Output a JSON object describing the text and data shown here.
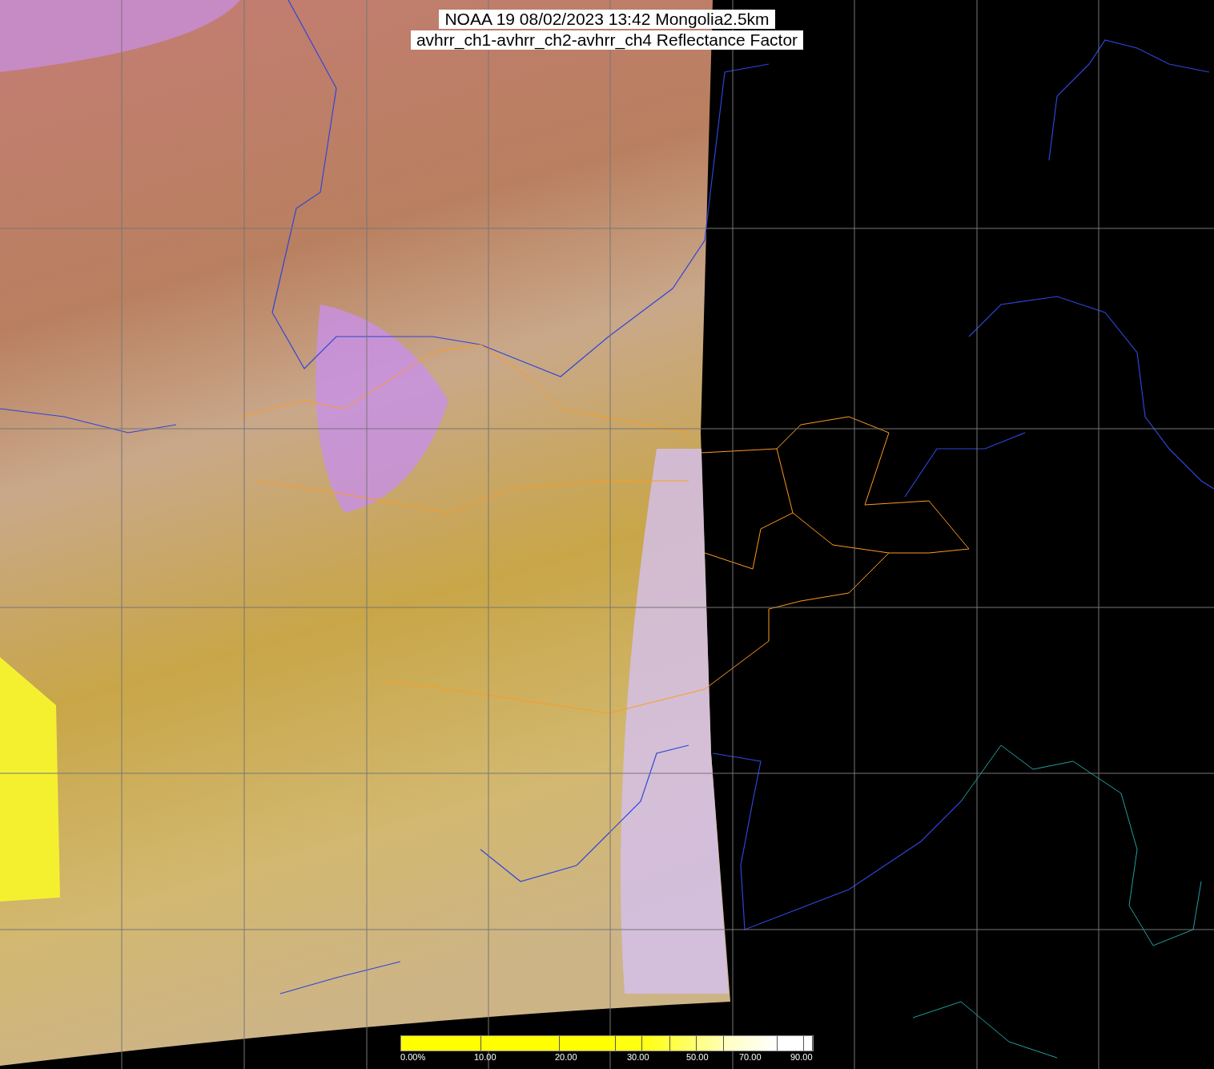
{
  "title": {
    "lines": [
      "NOAA 19 08/02/2023 13:42 Mongolia2.5km",
      "avhrr_ch1-avhrr_ch2-avhrr_ch4 Reflectance Factor"
    ]
  },
  "colorbar": {
    "labels": [
      "0.00%",
      "10.00",
      "20.00",
      "30.00",
      "50.00",
      "70.00",
      "90.00"
    ]
  }
}
